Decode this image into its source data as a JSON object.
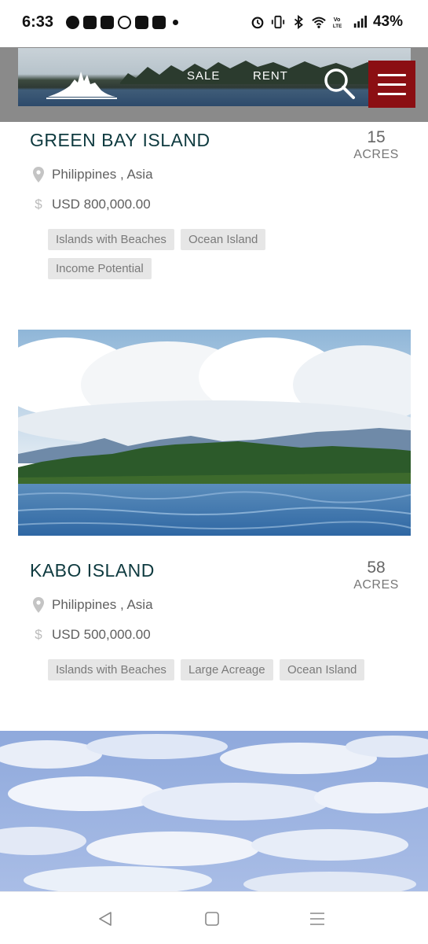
{
  "status_bar": {
    "time": "6:33",
    "battery": "43%",
    "left_icons": [
      "chat-icon",
      "teams-icon",
      "youtube-icon",
      "mercedes-icon",
      "youtube-icon",
      "chair-icon",
      "dot-icon"
    ],
    "right_icons": [
      "alarm-icon",
      "vibrate-icon",
      "bluetooth-icon",
      "wifi-icon",
      "volte-icon",
      "signal-icon"
    ]
  },
  "header": {
    "nav_sale": "SALE",
    "nav_rent": "RENT",
    "colors": {
      "menu_bg": "#8b0f13"
    }
  },
  "listings": [
    {
      "title": "GREEN BAY ISLAND",
      "acres": "15",
      "acres_unit": "ACRES",
      "location": "Philippines , Asia",
      "price": "USD 800,000.00",
      "tags": [
        "Islands with Beaches",
        "Ocean Island",
        "Income Potential"
      ]
    },
    {
      "title": "KABO ISLAND",
      "acres": "58",
      "acres_unit": "ACRES",
      "location": "Philippines , Asia",
      "price": "USD 500,000.00",
      "tags": [
        "Islands with Beaches",
        "Large Acreage",
        "Ocean Island"
      ]
    }
  ],
  "bottom_nav": {
    "icons": [
      "back-icon",
      "home-icon",
      "recents-icon"
    ]
  },
  "colors": {
    "title": "#0e3a3f",
    "tag_bg": "#e6e6e6",
    "tag_text": "#7a7a7a"
  }
}
